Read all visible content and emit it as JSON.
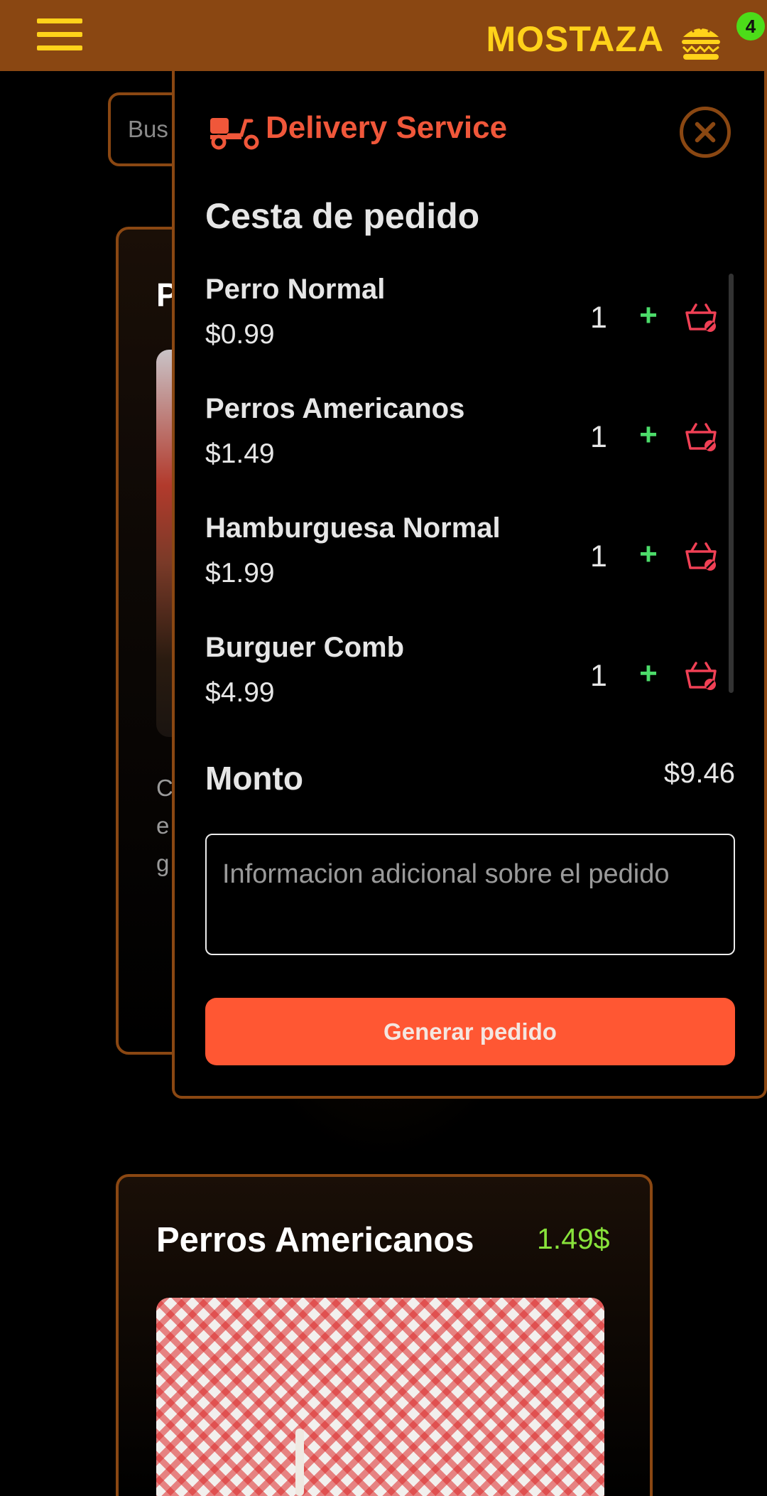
{
  "header": {
    "brand": "MOSTAZA",
    "cart_count": "4",
    "menu_icon": "hamburger-menu-icon",
    "cart_icon": "burger-icon"
  },
  "background": {
    "search_placeholder": "Bus",
    "card1_initial": "P",
    "card1_desc": "C e a g",
    "card2": {
      "title": "Perros Americanos",
      "price": "1.49$"
    }
  },
  "drawer": {
    "service_title": "Delivery Service",
    "service_icon": "delivery-scooter-icon",
    "close_icon": "close-circle-icon",
    "basket_title": "Cesta de pedido",
    "items": [
      {
        "name": "Perro Normal",
        "price": "$0.99",
        "qty": "1"
      },
      {
        "name": "Perros Americanos",
        "price": "$1.49",
        "qty": "1"
      },
      {
        "name": "Hamburguesa Normal",
        "price": "$1.99",
        "qty": "1"
      },
      {
        "name": "Burguer Comb",
        "price": "$4.99",
        "qty": "1"
      }
    ],
    "plus_symbol": "+",
    "remove_icon": "basket-remove-icon",
    "total_label": "Monto",
    "total_value": "$9.46",
    "notes_placeholder": "Informacion adicional sobre el pedido",
    "submit_label": "Generar pedido"
  },
  "colors": {
    "header_bg": "#8a4712",
    "brand_yellow": "#ffd21a",
    "accent_orange": "#ff5733",
    "title_red": "#f0573a",
    "plus_green": "#4cdc6a",
    "price_green": "#88e23b"
  }
}
